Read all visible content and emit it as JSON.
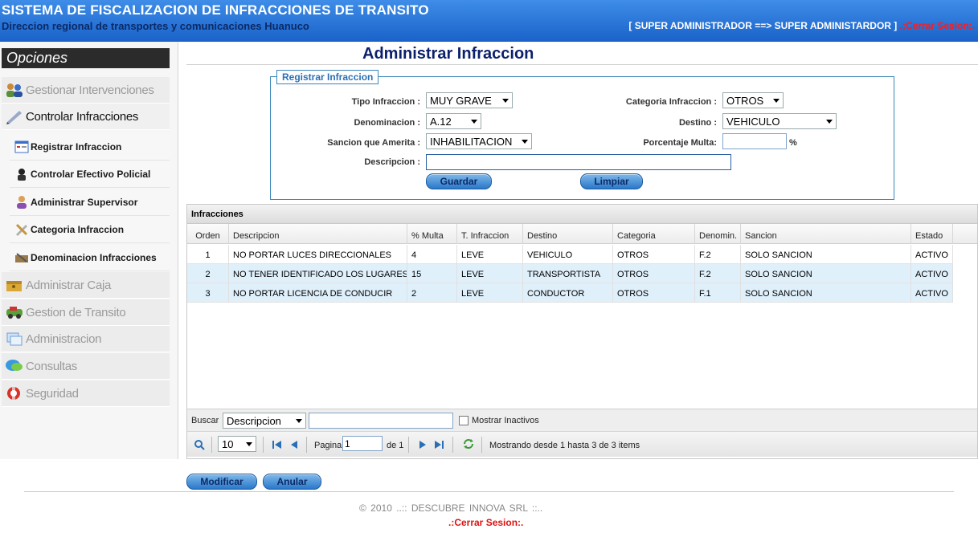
{
  "header": {
    "title": "SISTEMA DE FISCALIZACION DE INFRACCIONES DE TRANSITO",
    "subtitle": "Direccion regional de transportes y comunicaciones Huanuco",
    "user": "[ SUPER ADMINISTRADOR ==> SUPER ADMINISTARDOR ]",
    "logout": ".:Cerrar Sesion:."
  },
  "sidebar": {
    "title": "Opciones",
    "menu": [
      {
        "label": "Gestionar Intervenciones",
        "icon": "people-icon"
      },
      {
        "label": "Controlar Infracciones",
        "icon": "pen-icon"
      },
      {
        "label": "Administrar Caja",
        "icon": "cash-box-icon"
      },
      {
        "label": "Gestion de Transito",
        "icon": "car-icon"
      },
      {
        "label": "Administracion",
        "icon": "cards-icon"
      },
      {
        "label": "Consultas",
        "icon": "chat-icon"
      },
      {
        "label": "Seguridad",
        "icon": "lifebuoy-icon"
      }
    ],
    "submenu": [
      {
        "label": "Registrar Infraccion",
        "icon": "form-icon"
      },
      {
        "label": "Controlar Efectivo Policial",
        "icon": "police-icon"
      },
      {
        "label": "Administrar Supervisor",
        "icon": "supervisor-icon"
      },
      {
        "label": "Categoria Infraccion",
        "icon": "tools-icon"
      },
      {
        "label": "Denominacion Infracciones",
        "icon": "tag-icon"
      }
    ]
  },
  "page": {
    "title": "Administrar Infraccion"
  },
  "form": {
    "legend": "Registrar Infraccion",
    "tipo_label": "Tipo Infraccion :",
    "tipo_value": "MUY GRAVE",
    "categoria_label": "Categoria Infraccion :",
    "categoria_value": "OTROS",
    "denominacion_label": "Denominacion :",
    "denominacion_value": "A.12",
    "destino_label": "Destino :",
    "destino_value": "VEHICULO",
    "sancion_label": "Sancion que Amerita :",
    "sancion_value": "INHABILITACION",
    "porcentaje_label": "Porcentaje Multa:",
    "porcentaje_value": "",
    "porcentaje_unit": "%",
    "descripcion_label": "Descripcion :",
    "descripcion_value": "",
    "guardar": "Guardar",
    "limpiar": "Limpiar"
  },
  "grid": {
    "caption": "Infracciones",
    "headers": [
      "Orden",
      "Descripcion",
      "% Multa",
      "T. Infraccion",
      "Destino",
      "Categoria",
      "Denomin.",
      "Sancion",
      "Estado"
    ],
    "rows": [
      [
        "1",
        "NO PORTAR LUCES DIRECCIONALES",
        "4",
        "LEVE",
        "VEHICULO",
        "OTROS",
        "F.2",
        "SOLO SANCION",
        "ACTIVO"
      ],
      [
        "2",
        "NO TENER IDENTIFICADO LOS LUGARES DE",
        "15",
        "LEVE",
        "TRANSPORTISTA",
        "OTROS",
        "F.2",
        "SOLO SANCION",
        "ACTIVO"
      ],
      [
        "3",
        "NO PORTAR LICENCIA DE CONDUCIR",
        "2",
        "LEVE",
        "CONDUCTOR",
        "OTROS",
        "F.1",
        "SOLO SANCION",
        "ACTIVO"
      ]
    ]
  },
  "search": {
    "label": "Buscar",
    "field": "Descripcion",
    "value": "",
    "show_inactive": "Mostrar Inactivos"
  },
  "pager": {
    "page_size": "10",
    "page_label": "Pagina",
    "page": "1",
    "of": "de 1",
    "status": "Mostrando desde 1 hasta 3 de 3 items"
  },
  "actions": {
    "modificar": "Modificar",
    "anular": "Anular"
  },
  "footer": {
    "copyright": "© 2010        ..::   DESCUBRE INNOVA SRL ::..",
    "logout": ".:Cerrar Sesion:."
  }
}
